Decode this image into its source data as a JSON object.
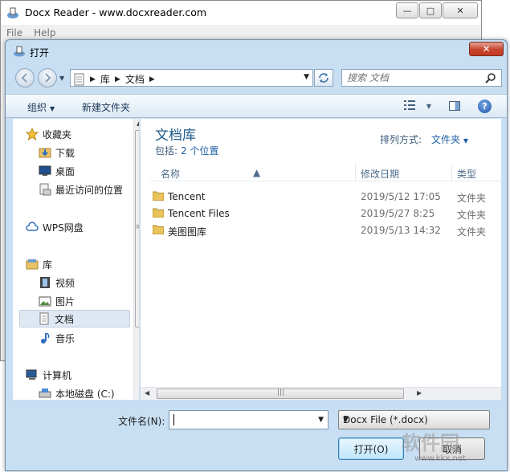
{
  "main_window": {
    "title": "Docx Reader - www.docxreader.com",
    "menu": [
      "File",
      "Help"
    ],
    "caption_minimize": "—",
    "caption_maximize": "□",
    "caption_close": "✕"
  },
  "dialog": {
    "title": "打开",
    "close_glyph": "✕",
    "address": {
      "crumbs": [
        "库",
        "文档"
      ]
    },
    "search": {
      "placeholder": "搜索 文档"
    },
    "toolbar": {
      "organize": "组织",
      "new_folder": "新建文件夹"
    },
    "nav_pane": {
      "favorites": {
        "label": "收藏夹",
        "items": [
          "下载",
          "桌面",
          "最近访问的位置"
        ]
      },
      "wps": "WPS网盘",
      "libraries": {
        "label": "库",
        "items": [
          "视频",
          "图片",
          "文档",
          "音乐"
        ],
        "selected": "文档"
      },
      "computer": {
        "label": "计算机",
        "items": [
          "本地磁盘 (C:)"
        ]
      }
    },
    "library": {
      "title": "文档库",
      "includes_label": "包括:",
      "includes_link": "2 个位置",
      "arrange_label": "排列方式:",
      "arrange_value": "文件夹"
    },
    "columns": [
      "名称",
      "修改日期",
      "类型"
    ],
    "files": [
      {
        "name": "Tencent",
        "date": "2019/5/12 17:05",
        "type": "文件夹"
      },
      {
        "name": "Tencent Files",
        "date": "2019/5/27 8:25",
        "type": "文件夹"
      },
      {
        "name": "美图图库",
        "date": "2019/5/13 14:32",
        "type": "文件夹"
      }
    ],
    "filename_label": "文件名(N):",
    "filename_value": "",
    "filetype_value": "Docx File (*.docx)",
    "open_button": "打开(O)",
    "cancel_button": "取消"
  },
  "watermark": {
    "text": "软件园",
    "sub": "www.kkx.net"
  },
  "colors": {
    "accent": "#1e5d8c",
    "link": "#1d5fa5",
    "close_red": "#c7442d",
    "frame": "#c8dff3"
  }
}
